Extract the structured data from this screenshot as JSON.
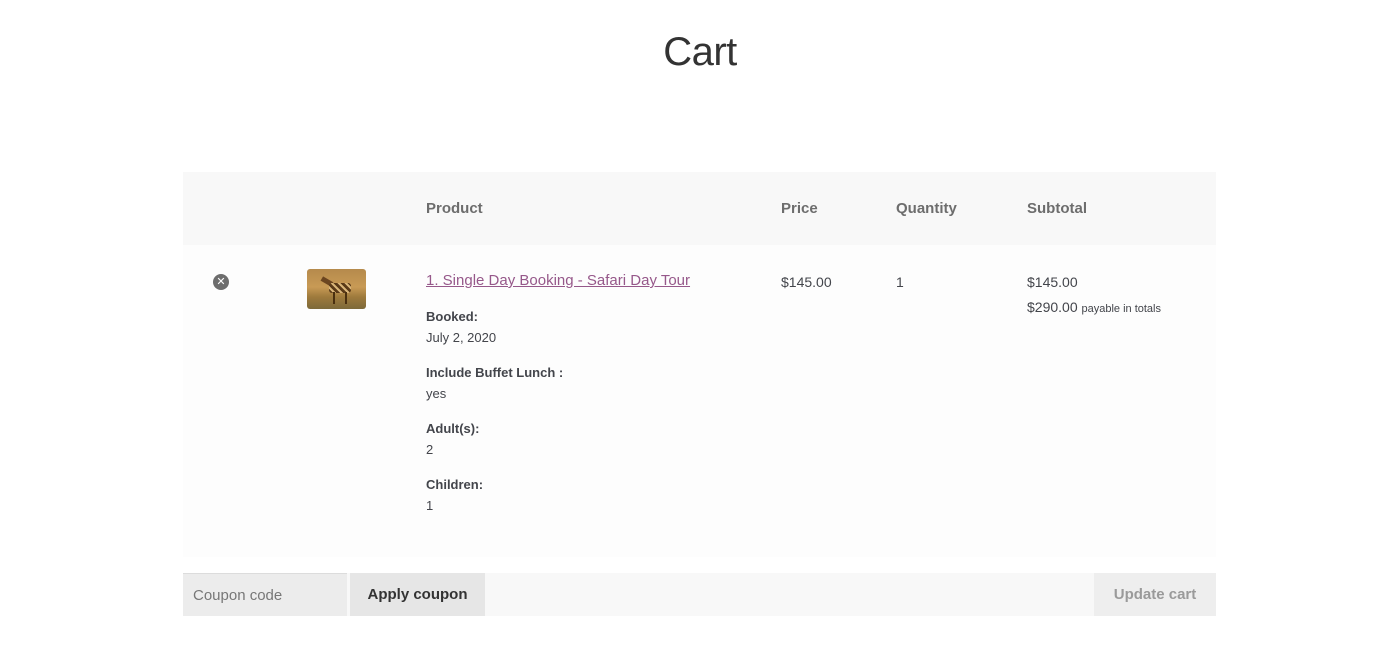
{
  "page": {
    "title": "Cart"
  },
  "table": {
    "headers": {
      "product": "Product",
      "price": "Price",
      "quantity": "Quantity",
      "subtotal": "Subtotal"
    },
    "items": [
      {
        "remove_glyph": "✕",
        "thumbnail_icon": "giraffe-safari-image",
        "name": "1. Single Day Booking - Safari Day Tour",
        "meta": [
          {
            "key": "Booked:",
            "value": "July 2, 2020"
          },
          {
            "key": "Include Buffet Lunch :",
            "value": "yes"
          },
          {
            "key": "Adult(s):",
            "value": "2"
          },
          {
            "key": "Children:",
            "value": "1"
          }
        ],
        "price": "$145.00",
        "quantity": "1",
        "subtotal": "$145.00",
        "total_amount": "$290.00",
        "total_note": "payable in totals"
      }
    ]
  },
  "actions": {
    "coupon_placeholder": "Coupon code",
    "apply_label": "Apply coupon",
    "update_label": "Update cart"
  },
  "colors": {
    "link": "#96588a",
    "header_bg": "#f8f8f8"
  }
}
